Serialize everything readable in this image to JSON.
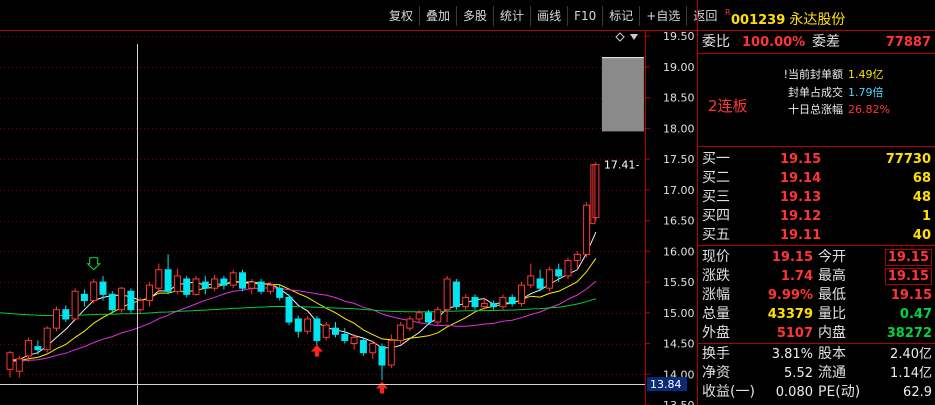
{
  "toolbar": [
    {
      "id": "fuquan",
      "label": "复权"
    },
    {
      "id": "overlay",
      "label": "叠加"
    },
    {
      "id": "multistock",
      "label": "多股"
    },
    {
      "id": "stats",
      "label": "统计"
    },
    {
      "id": "drawline",
      "label": "画线"
    },
    {
      "id": "f10",
      "label": "F10"
    },
    {
      "id": "marks",
      "label": "标记"
    },
    {
      "id": "add-watch",
      "label": "+自选"
    },
    {
      "id": "back",
      "label": "返回"
    }
  ],
  "stock": {
    "badge": "R",
    "code": "001239",
    "name": "永达股份"
  },
  "order_ratio": {
    "label": "委比",
    "value": "100.00%",
    "diff_label": "委差",
    "diff_value": "77887"
  },
  "seal_info": [
    {
      "label": "!当前封单额",
      "value": "1.49亿"
    },
    {
      "label": "封单占成交",
      "value": "1.79倍"
    },
    {
      "label": "十日总涨幅",
      "value": "26.82%"
    }
  ],
  "streak": "2连板",
  "bids": [
    {
      "label": "买一",
      "price": "19.15",
      "volume": "77730"
    },
    {
      "label": "买二",
      "price": "19.14",
      "volume": "68"
    },
    {
      "label": "买三",
      "price": "19.13",
      "volume": "48"
    },
    {
      "label": "买四",
      "price": "19.12",
      "volume": "1"
    },
    {
      "label": "买五",
      "price": "19.11",
      "volume": "40"
    }
  ],
  "quote": [
    {
      "l1": "现价",
      "v1": "19.15",
      "c1": "red",
      "l2": "今开",
      "v2": "19.15",
      "c2": "red",
      "box2": true
    },
    {
      "l1": "涨跌",
      "v1": "1.74",
      "c1": "red",
      "l2": "最高",
      "v2": "19.15",
      "c2": "red",
      "box2": true
    },
    {
      "l1": "涨幅",
      "v1": "9.99%",
      "c1": "red",
      "l2": "最低",
      "v2": "19.15",
      "c2": "red",
      "box2": false
    },
    {
      "l1": "总量",
      "v1": "43379",
      "c1": "yellow",
      "l2": "量比",
      "v2": "0.47",
      "c2": "green",
      "box2": false
    },
    {
      "l1": "外盘",
      "v1": "5107",
      "c1": "red",
      "l2": "内盘",
      "v2": "38272",
      "c2": "green",
      "box2": false
    }
  ],
  "fundamentals": [
    {
      "l1": "换手",
      "v1": "3.81%",
      "l2": "股本",
      "v2": "2.40亿"
    },
    {
      "l1": "净资",
      "v1": "5.52",
      "l2": "流通",
      "v2": "1.14亿"
    },
    {
      "l1": "收益(一)",
      "v1": "0.080",
      "l2": "PE(动)",
      "v2": "62.9"
    }
  ],
  "colors": {
    "up": "#ff3535",
    "down": "#00e5ee",
    "ma5": "#f0f0f0",
    "ma10": "#ffee00",
    "ma20": "#e030e0",
    "ma60": "#00cc33",
    "panel_border": "#b40000"
  },
  "chart_data": {
    "type": "candlestick",
    "price_axis": {
      "min": 13.5,
      "max": 19.6,
      "ticks": [
        "19.50",
        "19.00",
        "18.50",
        "18.00",
        "17.50",
        "17.00",
        "16.50",
        "16.00",
        "15.50",
        "15.00",
        "14.50",
        "14.00",
        "13.50"
      ]
    },
    "last_price_tag": "17.41",
    "cursor_price_tag": "13.84",
    "candles": [
      [
        14.08,
        14.35,
        13.95,
        14.38
      ],
      [
        14.05,
        14.25,
        13.95,
        14.3
      ],
      [
        14.3,
        14.55,
        14.2,
        14.6
      ],
      [
        14.45,
        14.4,
        14.32,
        14.55
      ],
      [
        14.4,
        14.75,
        14.35,
        14.78
      ],
      [
        14.75,
        15.05,
        14.7,
        15.1
      ],
      [
        15.05,
        14.9,
        14.85,
        15.12
      ],
      [
        14.9,
        15.35,
        14.88,
        15.4
      ],
      [
        15.3,
        15.2,
        15.1,
        15.38
      ],
      [
        15.2,
        15.5,
        15.15,
        15.55
      ],
      [
        15.5,
        15.3,
        15.2,
        15.6
      ],
      [
        15.3,
        15.05,
        15.0,
        15.35
      ],
      [
        15.05,
        15.4,
        15.0,
        15.42
      ],
      [
        15.35,
        15.05,
        15.0,
        15.4
      ],
      [
        15.05,
        15.2,
        14.98,
        15.25
      ],
      [
        15.2,
        15.45,
        15.1,
        15.5
      ],
      [
        15.4,
        15.7,
        15.35,
        15.8
      ],
      [
        15.7,
        15.35,
        15.3,
        15.95
      ],
      [
        15.35,
        15.6,
        15.3,
        15.72
      ],
      [
        15.55,
        15.3,
        15.25,
        15.6
      ],
      [
        15.3,
        15.55,
        15.28,
        15.6
      ],
      [
        15.5,
        15.4,
        15.3,
        15.6
      ],
      [
        15.4,
        15.55,
        15.35,
        15.62
      ],
      [
        15.55,
        15.45,
        15.38,
        15.6
      ],
      [
        15.45,
        15.65,
        15.4,
        15.7
      ],
      [
        15.65,
        15.4,
        15.35,
        15.7
      ],
      [
        15.4,
        15.5,
        15.3,
        15.55
      ],
      [
        15.5,
        15.35,
        15.3,
        15.55
      ],
      [
        15.35,
        15.45,
        15.3,
        15.5
      ],
      [
        15.4,
        15.25,
        15.2,
        15.45
      ],
      [
        15.25,
        14.85,
        14.8,
        15.3
      ],
      [
        14.9,
        14.7,
        14.6,
        14.95
      ],
      [
        14.7,
        14.9,
        14.65,
        14.95
      ],
      [
        14.9,
        14.55,
        14.45,
        14.95
      ],
      [
        14.6,
        14.8,
        14.55,
        14.85
      ],
      [
        14.75,
        14.65,
        14.6,
        14.85
      ],
      [
        14.65,
        14.55,
        14.5,
        14.75
      ],
      [
        14.5,
        14.6,
        14.4,
        14.65
      ],
      [
        14.55,
        14.35,
        14.3,
        14.6
      ],
      [
        14.35,
        14.5,
        14.25,
        14.55
      ],
      [
        14.45,
        14.15,
        13.9,
        14.5
      ],
      [
        14.15,
        14.55,
        14.1,
        14.65
      ],
      [
        14.55,
        14.8,
        14.5,
        14.85
      ],
      [
        14.75,
        14.9,
        14.7,
        14.95
      ],
      [
        14.9,
        15.0,
        14.85,
        15.05
      ],
      [
        15.0,
        14.85,
        14.8,
        15.05
      ],
      [
        14.85,
        15.05,
        14.8,
        15.1
      ],
      [
        15.05,
        15.55,
        14.85,
        15.6
      ],
      [
        15.5,
        15.1,
        15.05,
        15.55
      ],
      [
        15.1,
        15.25,
        15.05,
        15.3
      ],
      [
        15.25,
        15.1,
        15.05,
        15.3
      ],
      [
        15.1,
        15.15,
        15.05,
        15.25
      ],
      [
        15.15,
        15.1,
        15.05,
        15.2
      ],
      [
        15.1,
        15.25,
        15.05,
        15.3
      ],
      [
        15.25,
        15.15,
        15.1,
        15.3
      ],
      [
        15.15,
        15.45,
        15.1,
        15.5
      ],
      [
        15.45,
        15.6,
        15.4,
        15.8
      ],
      [
        15.55,
        15.4,
        15.35,
        15.7
      ],
      [
        15.4,
        15.7,
        15.35,
        15.75
      ],
      [
        15.7,
        15.6,
        15.5,
        15.8
      ],
      [
        15.6,
        15.85,
        15.55,
        15.9
      ],
      [
        15.85,
        15.95,
        15.7,
        16.0
      ],
      [
        15.95,
        16.75,
        15.9,
        16.8
      ],
      [
        16.55,
        17.41,
        16.5,
        17.45
      ]
    ],
    "limit_block": {
      "top": 19.15,
      "bottom": 17.95
    },
    "markers": [
      {
        "type": "arrow-down-outline",
        "index": 9,
        "price": 15.7
      },
      {
        "type": "arrow-up",
        "index": 33,
        "price": 14.4
      },
      {
        "type": "arrow-up",
        "index": 40,
        "price": 13.8
      }
    ]
  }
}
